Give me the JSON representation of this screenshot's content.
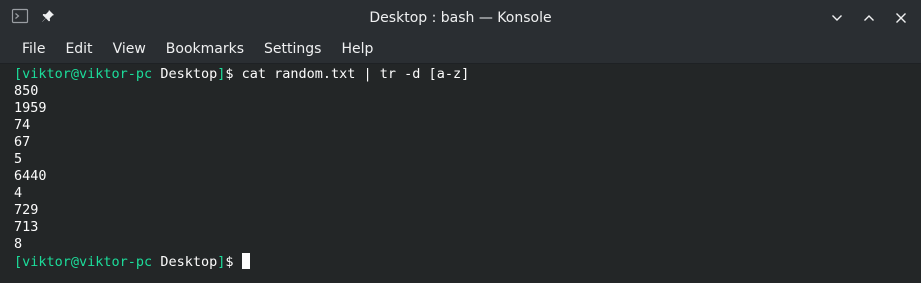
{
  "window": {
    "title": "Desktop : bash — Konsole"
  },
  "icons": {
    "app": "konsole-icon",
    "pin": "pin-icon",
    "minimize": "chevron-down-icon",
    "maximize": "chevron-up-icon",
    "close": "close-icon"
  },
  "menu": {
    "items": [
      "File",
      "Edit",
      "View",
      "Bookmarks",
      "Settings",
      "Help"
    ]
  },
  "terminal": {
    "prompt": {
      "open": "[",
      "user_host": "viktor@viktor-pc",
      "dir": " Desktop",
      "close": "]",
      "symbol": "$ "
    },
    "command": "cat random.txt | tr -d [a-z]",
    "output": [
      "850",
      "1959",
      "74",
      "67",
      "5",
      "6440",
      "4",
      "729",
      "713",
      "8"
    ]
  },
  "colors": {
    "prompt_green": "#1cdc9a",
    "text": "#fcfcfc",
    "background": "#232627",
    "titlebar": "#2a2e32"
  }
}
